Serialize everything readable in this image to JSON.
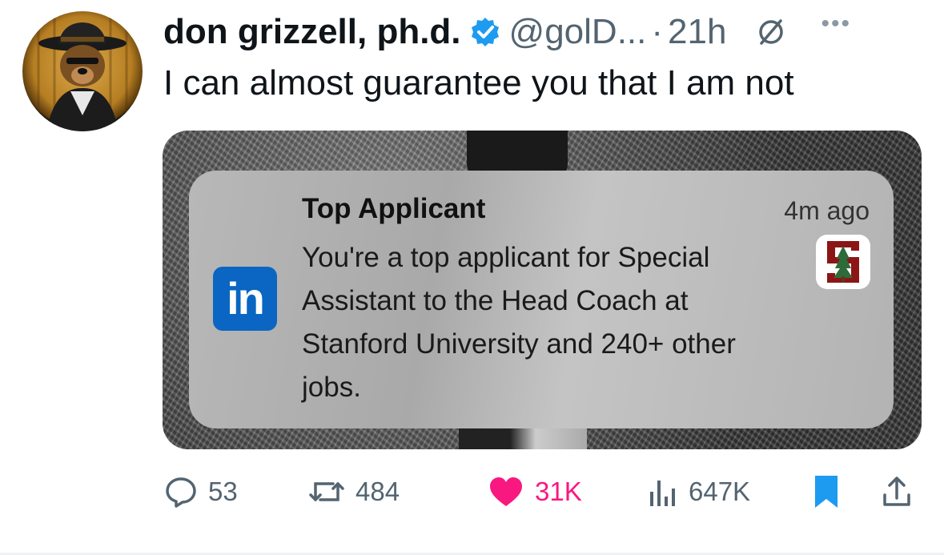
{
  "author": {
    "display_name": "don grizzell, ph.d.",
    "handle": "@golD...",
    "separator": "·",
    "time": "21h",
    "verified_icon": "verified-badge-icon",
    "verified_color": "#1d9bf0"
  },
  "tweet": {
    "text": "I can almost guarantee you that I am not"
  },
  "notification": {
    "app_logo_text": "in",
    "app_logo_color": "#0a66c2",
    "title": "Top Applicant",
    "time": "4m ago",
    "body": "You're a top applicant for Special Assistant to the Head Coach at Stanford University and 240+ other jobs.",
    "org_logo": "stanford-logo-icon"
  },
  "actions": {
    "replies": "53",
    "reposts": "484",
    "likes": "31K",
    "views": "647K",
    "like_color": "#f91880",
    "bookmark_color": "#1d9bf0"
  }
}
